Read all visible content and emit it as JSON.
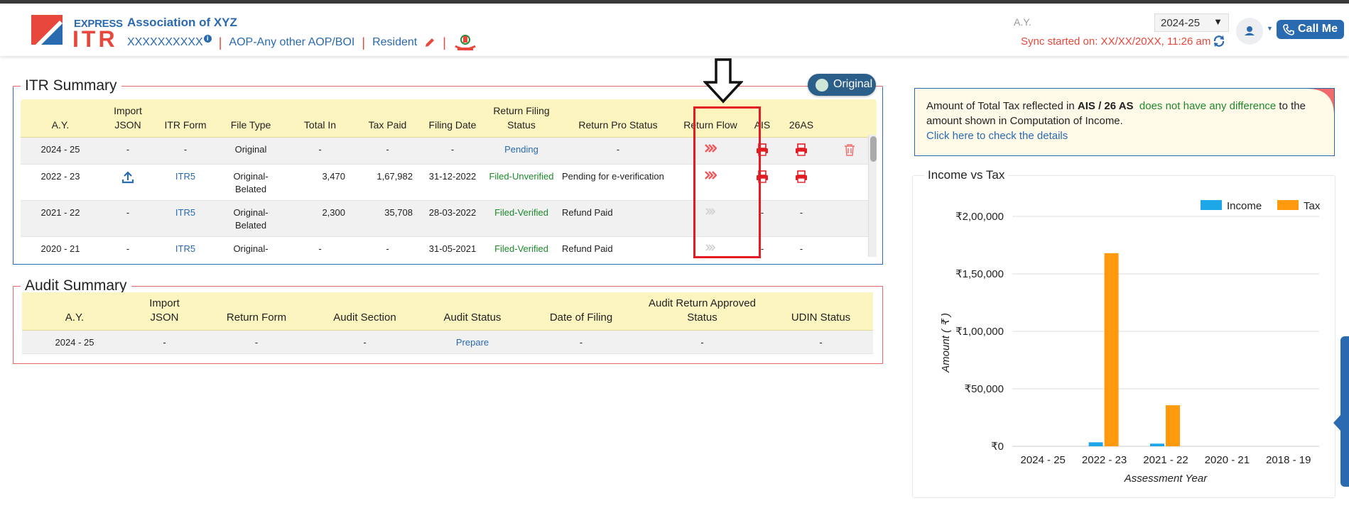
{
  "header": {
    "logo_top": "EXPRESS",
    "logo_main": "ITR",
    "entity_name": "Association of XYZ",
    "pan": "XXXXXXXXXX",
    "info_badge": "i",
    "status": "AOP-Any other AOP/BOI",
    "residency": "Resident",
    "ay_label": "A.Y.",
    "ay_selected": "2024-25",
    "sync_text": "Sync started on: XX/XX/20XX, 11:26 am",
    "call_me": "Call Me"
  },
  "itr_summary": {
    "title": "ITR Summary",
    "badge": "Original",
    "columns": [
      "A.Y.",
      "Import JSON",
      "ITR Form",
      "File Type",
      "Total In",
      "Tax Paid",
      "Filing Date",
      "Return Filing Status",
      "Return Pro Status",
      "Return Flow",
      "AIS",
      "26AS"
    ],
    "rows": [
      {
        "ay": "2024 - 25",
        "import": "-",
        "form": "-",
        "file_type": "Original",
        "total_in": "-",
        "tax_paid": "-",
        "filing_date": "-",
        "status": "Pending",
        "pro_status": "-",
        "ais": "print",
        "as26": "print"
      },
      {
        "ay": "2022 - 23",
        "import": "upload",
        "form": "ITR5",
        "file_type": "Original-Belated",
        "total_in": "3,470",
        "tax_paid": "1,67,982",
        "filing_date": "31-12-2022",
        "status": "Filed-Unverified",
        "pro_status": "Pending for e-verification",
        "ais": "print",
        "as26": "print"
      },
      {
        "ay": "2021 - 22",
        "import": "-",
        "form": "ITR5",
        "file_type": "Original-Belated",
        "total_in": "2,300",
        "tax_paid": "35,708",
        "filing_date": "28-03-2022",
        "status": "Filed-Verified",
        "pro_status": "Refund Paid",
        "ais": "-",
        "as26": "-"
      },
      {
        "ay": "2020 - 21",
        "import": "-",
        "form": "ITR5",
        "file_type": "Original-Belated",
        "total_in": "-",
        "tax_paid": "-",
        "filing_date": "31-05-2021",
        "status": "Filed-Verified",
        "pro_status": "Refund Paid",
        "ais": "-",
        "as26": "-"
      }
    ]
  },
  "audit_summary": {
    "title": "Audit Summary",
    "columns": [
      "A.Y.",
      "Import JSON",
      "Return Form",
      "Audit Section",
      "Audit Status",
      "Date of Filing",
      "Audit Return Approved Status",
      "UDIN Status"
    ],
    "rows": [
      {
        "ay": "2024 - 25",
        "import": "-",
        "form": "-",
        "section": "-",
        "status": "Prepare",
        "date": "-",
        "approved": "-",
        "udin": "-"
      }
    ]
  },
  "ais_panel": {
    "text_1": "Amount of Total Tax reflected in ",
    "bold": "AIS / 26 AS",
    "green": "does not have any difference",
    "text_2": " to the amount shown in Computation of Income.",
    "link": "Click here to check the details"
  },
  "chart_data": {
    "type": "bar",
    "title": "Income vs Tax",
    "categories": [
      "2024 - 25",
      "2022 - 23",
      "2021 - 22",
      "2020 - 21",
      "2018 - 19"
    ],
    "series": [
      {
        "name": "Income",
        "values": [
          0,
          3470,
          2300,
          0,
          0
        ],
        "color": "#1ea7e8"
      },
      {
        "name": "Tax",
        "values": [
          0,
          167982,
          35708,
          0,
          0
        ],
        "color": "#ff9a0e"
      }
    ],
    "xlabel": "Assessment Year",
    "ylabel": "Amount ( ₹ )",
    "ylim": [
      0,
      200000
    ],
    "yticks": [
      0,
      50000,
      100000,
      150000,
      200000
    ],
    "ytick_labels": [
      "₹0",
      "₹50,000",
      "₹1,00,000",
      "₹1,50,000",
      "₹2,00,000"
    ],
    "grid": true,
    "legend": "top-right"
  },
  "colors": {
    "brand": "#2a6ab0",
    "accent": "#e8473b",
    "header_row": "#fdf5bf",
    "highlight": "#e31c23"
  }
}
